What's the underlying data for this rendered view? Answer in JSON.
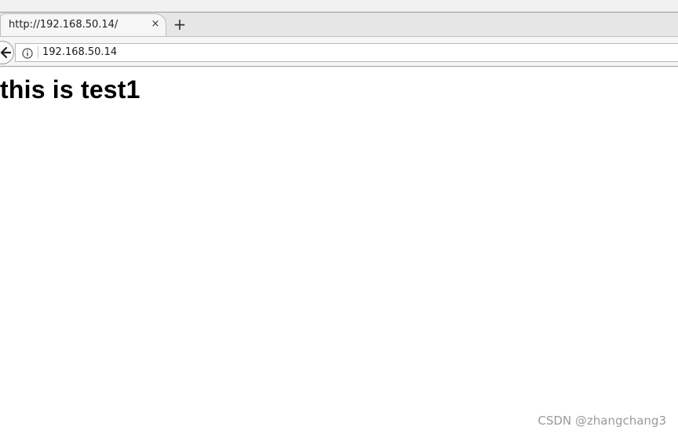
{
  "tab": {
    "title": "http://192.168.50.14/",
    "close_glyph": "×",
    "new_tab_glyph": "+"
  },
  "navigation": {
    "url": "192.168.50.14",
    "back_icon": "back-arrow-icon",
    "info_icon": "info-icon"
  },
  "page": {
    "heading": "this is test1"
  },
  "watermark": {
    "text": "CSDN @zhangchang3"
  }
}
